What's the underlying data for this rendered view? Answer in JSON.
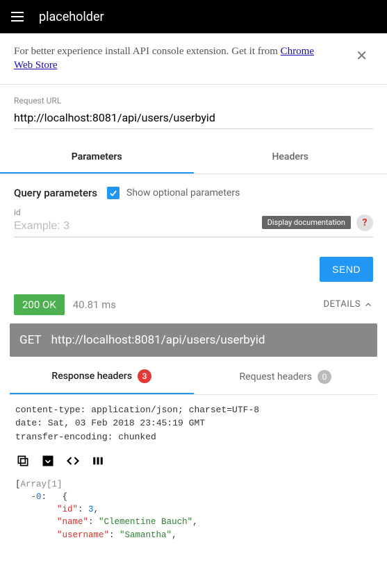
{
  "header": {
    "title": "placeholder"
  },
  "notice": {
    "text_before": "For better experience install API console extension. Get it from ",
    "link_text": "Chrome Web Store"
  },
  "request": {
    "url_label": "Request URL",
    "url_value": "http://localhost:8081/api/users/userbyid"
  },
  "tabs": {
    "parameters": "Parameters",
    "headers": "Headers"
  },
  "query": {
    "title": "Query parameters",
    "show_optional": "Show optional parameters",
    "param_label": "id",
    "param_placeholder": "Example: 3",
    "doc_tooltip": "Display documentation"
  },
  "send_label": "SEND",
  "response": {
    "status": "200 OK",
    "time": "40.81 ms",
    "details": "DETAILS",
    "method": "GET",
    "url": "http://localhost:8081/api/users/userbyid"
  },
  "resp_tabs": {
    "response_headers": "Response headers",
    "response_count": "3",
    "request_headers": "Request headers",
    "request_count": "0"
  },
  "headers_text": "content-type: application/json; charset=UTF-8\ndate: Sat, 03 Feb 2018 23:45:19 GMT\ntransfer-encoding: chunked",
  "json_body": {
    "array_label": "Array[1]",
    "index": "0",
    "id_key": "\"id\"",
    "id_val": "3",
    "name_key": "\"name\"",
    "name_val": "\"Clementine Bauch\"",
    "user_key": "\"username\"",
    "user_val": "\"Samantha\""
  }
}
